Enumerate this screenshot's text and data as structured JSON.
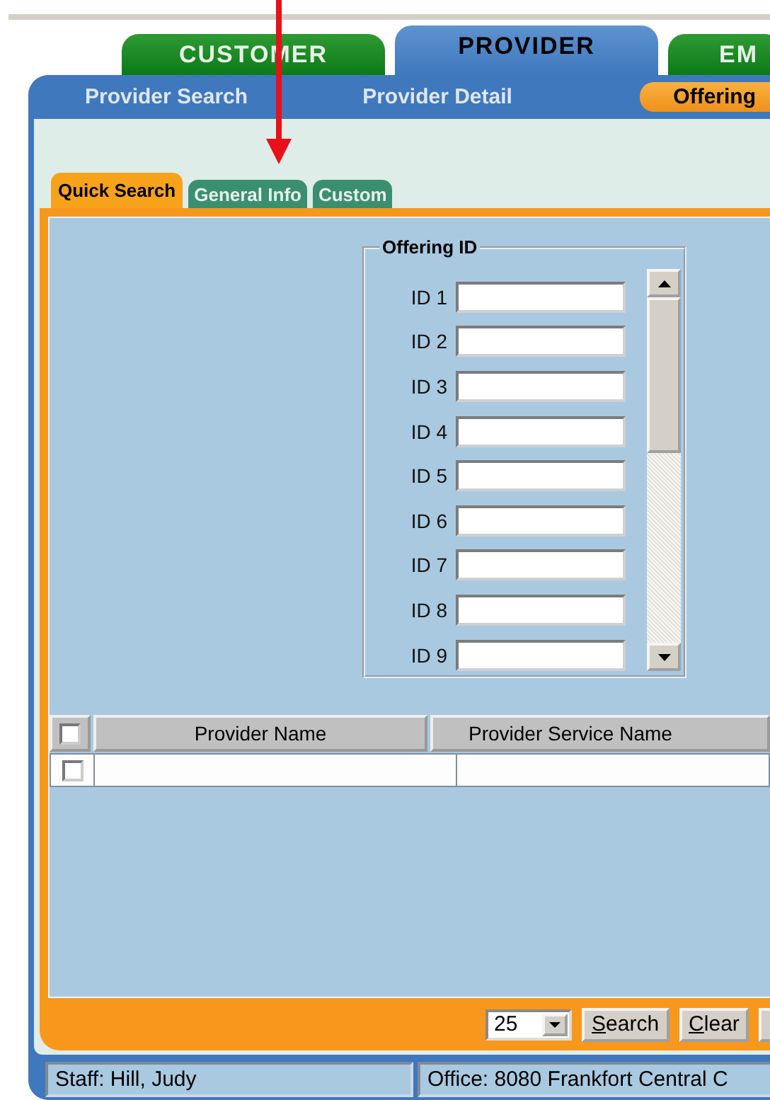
{
  "main_tabs": [
    {
      "label": "CUSTOMER",
      "selected": false
    },
    {
      "label": "PROVIDER",
      "selected": true
    },
    {
      "label": "EM",
      "selected": false
    }
  ],
  "sub_nav": [
    {
      "label": "Provider Search",
      "selected": false
    },
    {
      "label": "Provider Detail",
      "selected": false
    },
    {
      "label": "Offering",
      "selected": true
    }
  ],
  "search_tabs": [
    {
      "label": "Quick Search",
      "selected": true
    },
    {
      "label": "General Info",
      "selected": false
    },
    {
      "label": "Custom",
      "selected": false
    }
  ],
  "offering_id": {
    "title": "Offering ID",
    "fields": [
      {
        "label": "ID 1"
      },
      {
        "label": "ID 2"
      },
      {
        "label": "ID 3"
      },
      {
        "label": "ID 4"
      },
      {
        "label": "ID 5"
      },
      {
        "label": "ID 6"
      },
      {
        "label": "ID 7"
      },
      {
        "label": "ID 8"
      },
      {
        "label": "ID 9"
      }
    ]
  },
  "table": {
    "select_all_checked": false,
    "columns": [
      "Provider Name",
      "Provider Service Name"
    ],
    "rows": [
      {
        "checked": false
      }
    ]
  },
  "page_size": "25",
  "buttons": [
    "Search",
    "Clear"
  ],
  "status_bar": [
    "Staff: Hill, Judy",
    "Office: 8080 Frankfort Central C"
  ]
}
